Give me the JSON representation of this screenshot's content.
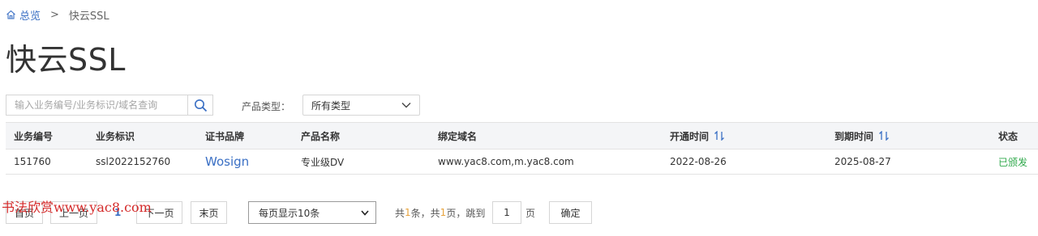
{
  "breadcrumb": {
    "home_label": "总览",
    "separator": ">",
    "current_label": "快云SSL"
  },
  "page": {
    "title": "快云SSL"
  },
  "filters": {
    "search_placeholder": "输入业务编号/业务标识/域名查询",
    "search_value": "",
    "product_type_label": "产品类型：",
    "product_type_value": "所有类型"
  },
  "table": {
    "columns": [
      {
        "label": "业务编号"
      },
      {
        "label": "业务标识"
      },
      {
        "label": "证书品牌"
      },
      {
        "label": "产品名称"
      },
      {
        "label": "绑定域名"
      },
      {
        "label": "开通时间",
        "sortable": true
      },
      {
        "label": "到期时间",
        "sortable": true
      },
      {
        "label": "状态"
      }
    ],
    "rows": [
      {
        "id": "151760",
        "identifier": "ssl2022152760",
        "brand": "Wosign",
        "product": "专业级DV",
        "domains": "www.yac8.com,m.yac8.com",
        "opened": "2022-08-26",
        "expires": "2025-08-27",
        "status": "已颁发"
      }
    ]
  },
  "pager": {
    "first": "首页",
    "prev": "上一页",
    "current_page": "1",
    "next": "下一页",
    "last": "末页",
    "per_page": "每页显示10条",
    "summary_prefix": "共",
    "total_items": "1",
    "summary_mid": "条，共",
    "total_pages": "1",
    "summary_suffix": "页，跳到",
    "jump_value": "1",
    "page_unit": "页",
    "confirm": "确定"
  },
  "watermark": {
    "text": "书法欣赏www.yac8.com"
  },
  "colors": {
    "link": "#3a6fc4",
    "status_ok": "#2ea84a",
    "header_bg": "#f4f5f7",
    "highlight_number": "#e8a33c",
    "watermark": "#d42a2a"
  }
}
